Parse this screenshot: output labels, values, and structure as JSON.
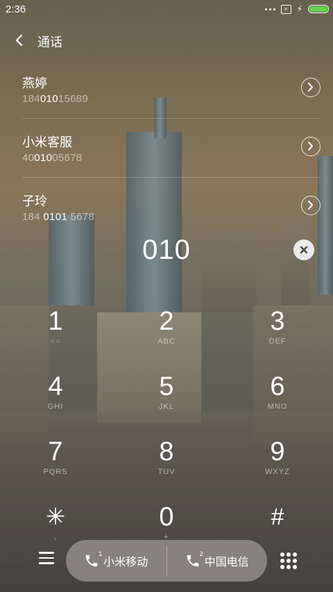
{
  "status": {
    "time": "2:36"
  },
  "header": {
    "title": "通话"
  },
  "contacts": [
    {
      "name": "燕婷",
      "num_pre": "184",
      "num_match": "010",
      "num_post": "15689"
    },
    {
      "name": "小米客服",
      "num_pre": "40",
      "num_match": "010",
      "num_post": "05678"
    },
    {
      "name": "子玲",
      "num_pre": "184 ",
      "num_match": "0101",
      "num_post": " 5678"
    }
  ],
  "dialed": "010",
  "keys": [
    {
      "digit": "1",
      "letters": "○○"
    },
    {
      "digit": "2",
      "letters": "ABC"
    },
    {
      "digit": "3",
      "letters": "DEF"
    },
    {
      "digit": "4",
      "letters": "GHI"
    },
    {
      "digit": "5",
      "letters": "JKL"
    },
    {
      "digit": "6",
      "letters": "MNO"
    },
    {
      "digit": "7",
      "letters": "PQRS"
    },
    {
      "digit": "8",
      "letters": "TUV"
    },
    {
      "digit": "9",
      "letters": "WXYZ"
    },
    {
      "digit": "✳",
      "letters": ","
    },
    {
      "digit": "0",
      "letters": "+"
    },
    {
      "digit": "#",
      "letters": ""
    }
  ],
  "sims": [
    {
      "slot": "1",
      "carrier": "小米移动"
    },
    {
      "slot": "2",
      "carrier": "中国电信"
    }
  ],
  "colors": {
    "battery": "#5fd34a"
  }
}
